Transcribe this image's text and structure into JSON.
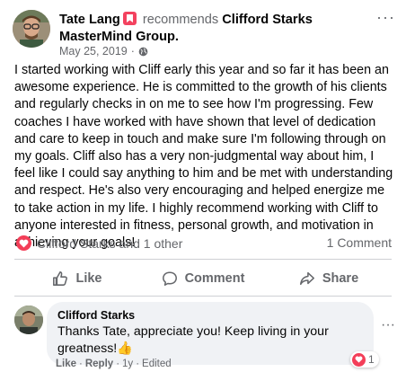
{
  "post": {
    "author": "Tate Lang",
    "verb": "recommends",
    "page": "Clifford Starks MasterMind Group.",
    "date": "May 25, 2019",
    "separator": "·",
    "more": "···",
    "body": "I started working with Cliff early this year and so far it has been an awesome experience. He is committed to the growth of his clients and regularly checks in on me to see how I'm progressing. Few coaches I have worked with have shown that level of dedication and care to keep in touch and make sure I'm following through on my goals. Cliff also has a very non-judgmental way about him, I feel like I could say anything to him and be met with understanding and respect. He's also very encouraging and helped energize me to take action in my life. I highly recommend working with Cliff to anyone interested in fitness, personal growth, and motivation in achieving your goals!"
  },
  "reactions": {
    "summary": "Clifford Starks and 1 other",
    "comment_count": "1 Comment",
    "icon": "love-reaction-icon"
  },
  "actions": {
    "like": "Like",
    "comment": "Comment",
    "share": "Share"
  },
  "comment": {
    "author": "Clifford Starks",
    "text": "Thanks Tate, appreciate you! Keep living in your greatness!👍",
    "like": "Like",
    "reply": "Reply",
    "time": "1y",
    "edited": "Edited",
    "dot": "·",
    "more": "···",
    "reaction_count": "1"
  },
  "colors": {
    "love": "#f33e58",
    "recommend_badge": "#f3425f",
    "secondary_text": "#65676b",
    "bubble": "#f0f2f5"
  }
}
